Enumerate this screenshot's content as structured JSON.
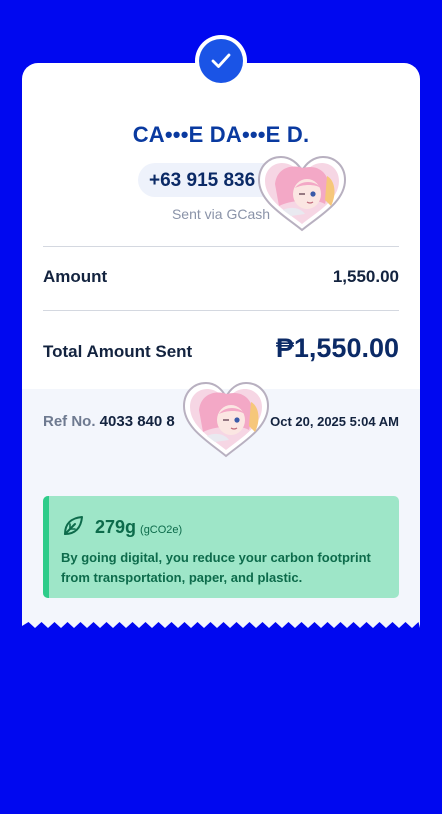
{
  "recipient": {
    "name": "CA•••E DA•••E D.",
    "phone": "+63 915 836",
    "sent_via": "Sent via GCash"
  },
  "amount_row": {
    "label": "Amount",
    "value": "1,550.00"
  },
  "total_row": {
    "label": "Total Amount Sent",
    "value": "₱1,550.00"
  },
  "reference": {
    "label": "Ref No.",
    "number": "4033 840 8",
    "timestamp": "Oct 20, 2025 5:04 AM"
  },
  "carbon": {
    "amount": "279g",
    "unit": "(gCO2e)",
    "message": "By going digital, you reduce your carbon footprint from transportation, paper, and plastic."
  },
  "icons": {
    "status": "checkmark-icon",
    "carbon": "leaf-icon",
    "stickers": "heart-portrait-sticker"
  },
  "colors": {
    "background": "#0008f0",
    "accent_blue": "#1a54e6",
    "name_blue": "#0a3aa0",
    "carbon_green": "#9ee6c8",
    "carbon_text": "#0d6b4b"
  }
}
